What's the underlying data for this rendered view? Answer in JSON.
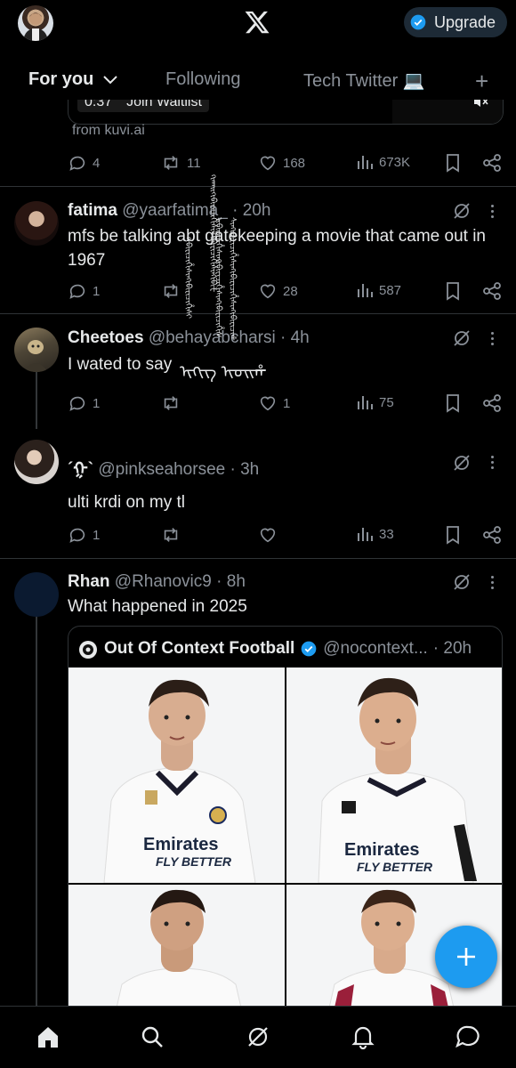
{
  "topbar": {
    "upgrade_label": "Upgrade",
    "tabs": [
      "For you",
      "Following",
      "Tech Twitter 💻"
    ]
  },
  "video_ad": {
    "time": "0:37",
    "cta": "Join Waitlist",
    "source": "from kuvi.ai",
    "stats": {
      "replies": "4",
      "reposts": "11",
      "likes": "168",
      "views": "673K"
    }
  },
  "tweets": [
    {
      "name": "fatima",
      "handle": "@yaarfatima_",
      "time": "· 20h",
      "text": "mfs be talking abt gatekeeping a movie that came out in 1967",
      "stats": {
        "replies": "1",
        "reposts": "",
        "likes": "28",
        "views": "587"
      }
    },
    {
      "name": "Cheetoes",
      "handle": "@behayabcharsi",
      "time": "· 4h",
      "text": "I wated to say",
      "stats": {
        "replies": "1",
        "reposts": "",
        "likes": "1",
        "views": "75"
      }
    },
    {
      "name": "´ᠭ`",
      "handle": "@pinkseahorsee",
      "time": "· 3h",
      "text": "ulti krdi on my tl",
      "stats": {
        "replies": "1",
        "reposts": "",
        "likes": "",
        "views": "33"
      }
    },
    {
      "name": "Rhan",
      "handle": "@Rhanovic9",
      "time": "· 8h",
      "text": "What happened in 2025"
    }
  ],
  "quoted": {
    "name": "Out Of Context Football",
    "handle": "@nocontext...",
    "time": "· 20h",
    "jersey_text_1": "Emirates",
    "jersey_text_2": "FLY BETTER"
  },
  "glitch_text": {
    "col1": "ᠭᡳᠬᠠᡳᠬᡳᠪᡳᡶᡳᠴᡳᡥᡳᠰᡳᠩᡳᠪᡳᡶᡳᠴᡳᡥᡳᠰᡳᠩᡳᠪᡳᡶ",
    "col2": "ᠬᡳᠪᡳᡶᡳᠴᡳᡥᡳᠰᡳᠩᡳᠪᡳᡶᡳᠴᡳᡥᡳᠰᡳ",
    "col3": "ᡳᠪᡳᡶᡳᠴᡳᡥᡳᠰᡳᠩᡳᠪᡳᡶᡳᠴᡳᡥᡳᠰᡳᠩᡳᠪᡳᡶᡳᠴᡳᡥᡳᠰ",
    "col4": "ᠰᡳᠩᡳᠪᡳᡶᡳᠴᡳᡥᡳᠰᡳᠩᡳᠪᡳᡶᡳᠴᡳᡥᡳᠰᡳᠩᡳᠪᡳᡶᡳᠴᡳᡥ",
    "overlay": "ᡳᠬᡳᠭ ᡳᠣᡳᡥ"
  },
  "colors": {
    "accent": "#1d9bf0",
    "muted": "#8b9199",
    "bg": "#000000"
  },
  "icons": [
    "x-logo-icon",
    "verified-icon",
    "chevron-down-icon",
    "plus-icon",
    "reply-icon",
    "repost-icon",
    "like-icon",
    "views-icon",
    "bookmark-icon",
    "share-icon",
    "grok-icon",
    "more-icon",
    "mute-icon",
    "home-icon",
    "search-icon",
    "notifications-icon",
    "messages-icon",
    "compose-icon"
  ]
}
